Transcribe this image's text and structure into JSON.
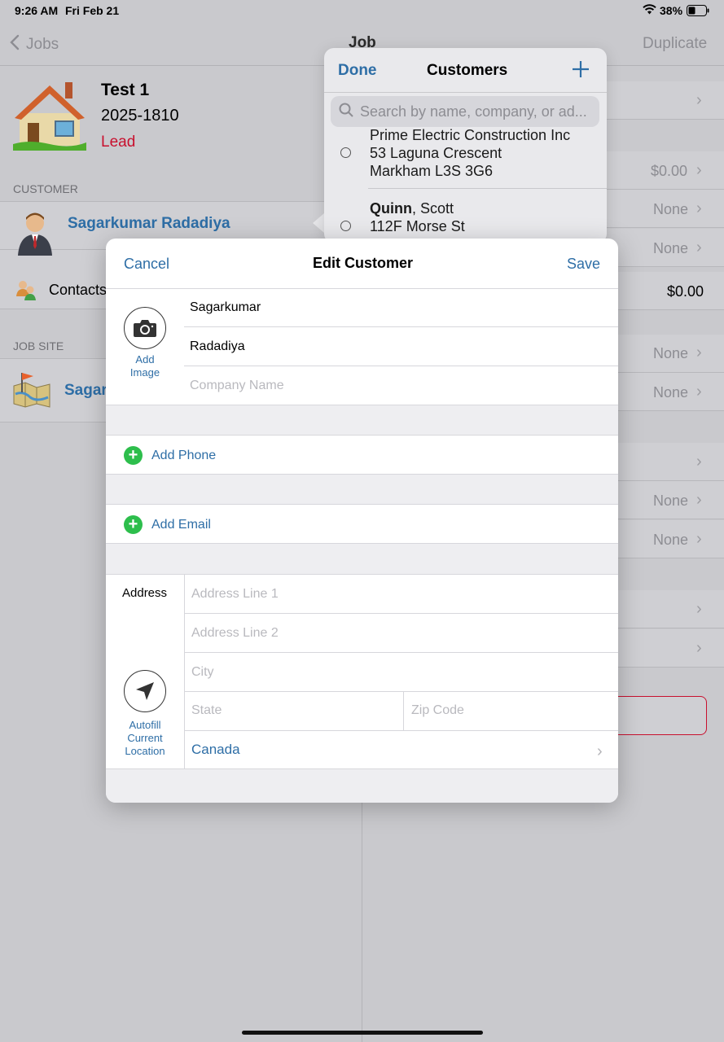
{
  "status_bar": {
    "time": "9:26 AM",
    "date": "Fri Feb 21",
    "battery": "38%"
  },
  "nav": {
    "back_label": "Jobs",
    "title": "Job",
    "duplicate_label": "Duplicate"
  },
  "job": {
    "title": "Test 1",
    "number": "2025-1810",
    "status": "Lead"
  },
  "left": {
    "customer_section": "CUSTOMER",
    "customer_name": "Sagarkumar Radadiya",
    "contacts_label": "Contacts",
    "job_site_section": "JOB SITE",
    "job_site_name": "Sagark"
  },
  "right_rows": [
    {
      "value": ""
    },
    {
      "value": "$0.00"
    },
    {
      "value": "None"
    },
    {
      "value": "None"
    },
    {
      "value": "$0.00"
    },
    {
      "value": "None"
    },
    {
      "value": "None"
    },
    {
      "value": ""
    },
    {
      "value": "None"
    },
    {
      "value": "None"
    },
    {
      "value": ""
    },
    {
      "value": ""
    }
  ],
  "popover": {
    "done_label": "Done",
    "title": "Customers",
    "search_placeholder": "Search by name, company, or ad...",
    "items": [
      {
        "line1": "Prime Electric Construction Inc",
        "line2": "53 Laguna Crescent",
        "line3": "Markham L3S 3G6"
      },
      {
        "last": "Quinn",
        "first": ", Scott",
        "line2": "112F Morse St"
      }
    ]
  },
  "modal": {
    "cancel_label": "Cancel",
    "title": "Edit Customer",
    "save_label": "Save",
    "add_image_label": "Add Image",
    "first_name": "Sagarkumar",
    "last_name": "Radadiya",
    "company_placeholder": "Company Name",
    "add_phone_label": "Add Phone",
    "add_email_label": "Add Email",
    "address_label": "Address",
    "address1_placeholder": "Address Line 1",
    "address2_placeholder": "Address Line 2",
    "city_placeholder": "City",
    "state_placeholder": "State",
    "zip_placeholder": "Zip Code",
    "autofill_label": "Autofill Current Location",
    "country": "Canada"
  }
}
